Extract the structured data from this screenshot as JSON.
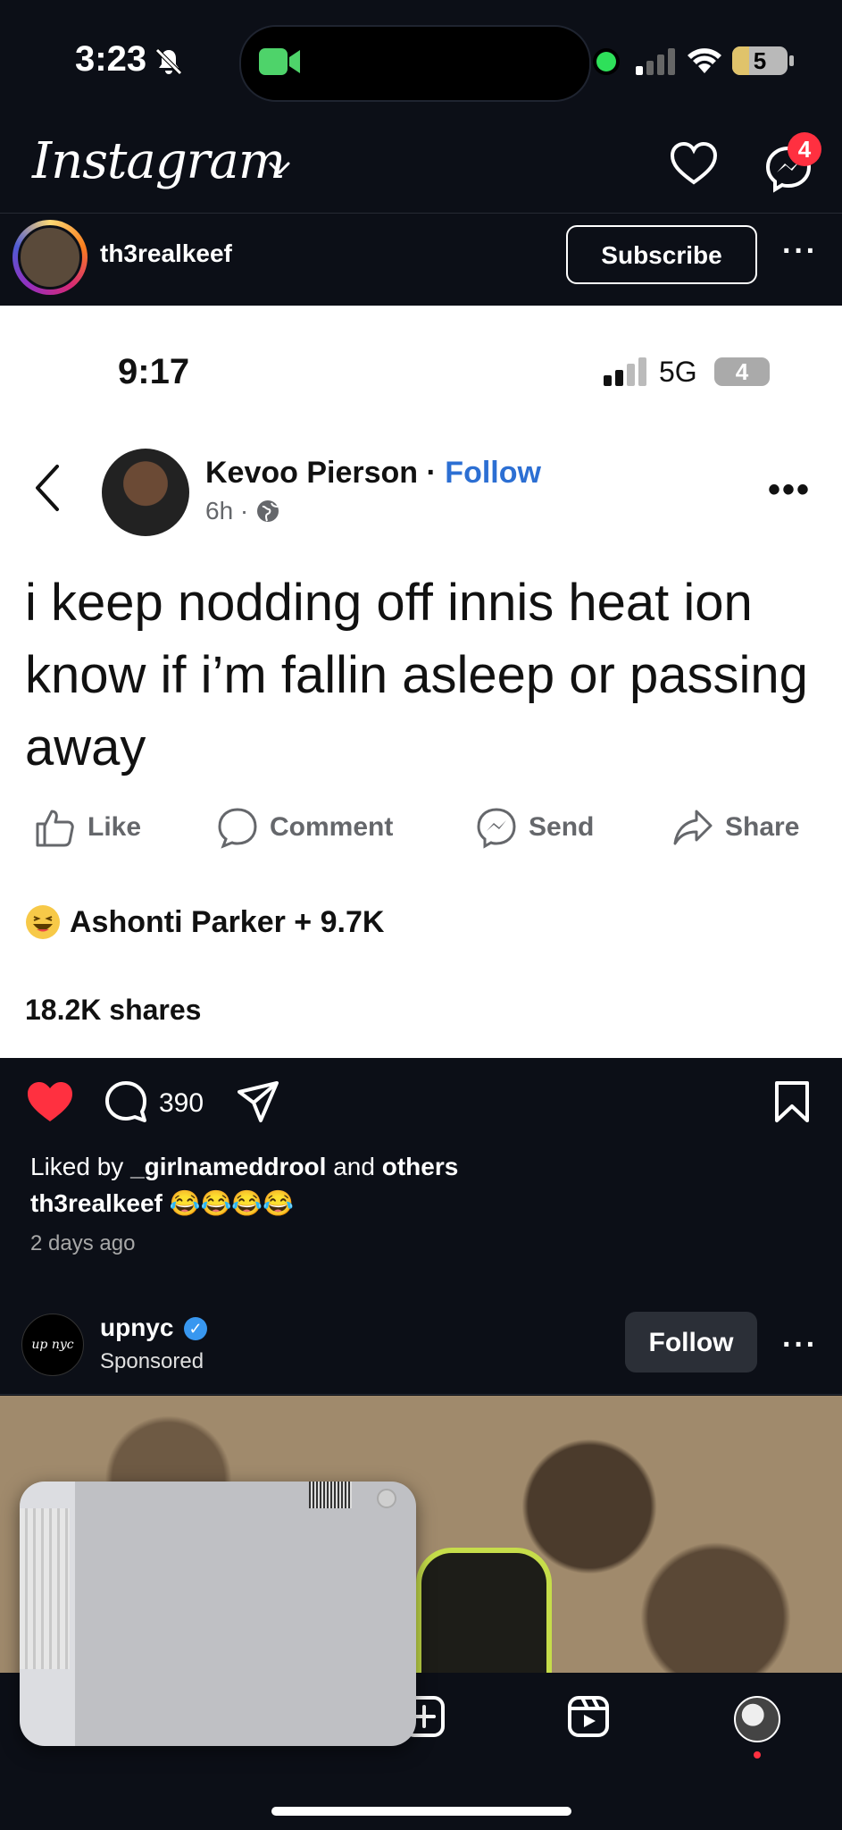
{
  "status_bar": {
    "time": "3:23",
    "battery": "5"
  },
  "header": {
    "logo": "Instagram",
    "messenger_badge": "4"
  },
  "story": {
    "username": "th3realkeef",
    "subscribe_label": "Subscribe",
    "more": "···"
  },
  "screenshot_post": {
    "status_time": "9:17",
    "network": "5G",
    "battery": "4",
    "author": "Kevoo Pierson",
    "separator": " · ",
    "follow_label": "Follow",
    "meta": "6h ·",
    "text": "i keep nodding off innis heat ion know if i’m fallin asleep or passing away",
    "actions": {
      "like": "Like",
      "comment": "Comment",
      "send": "Send",
      "share": "Share"
    },
    "reactions_text": "Ashonti Parker + 9.7K",
    "shares": "18.2K shares"
  },
  "ig_post": {
    "comment_count": "390",
    "liked_prefix": "Liked by ",
    "liked_user": "_girlnameddrool",
    "liked_middle": " and ",
    "liked_others": "others",
    "caption_user": "th3realkeef",
    "caption_text": " 😂😂😂😂",
    "time_ago": "2 days ago"
  },
  "sponsored": {
    "username": "upnyc",
    "label": "Sponsored",
    "follow_label": "Follow",
    "avatar_text": "up nyc"
  },
  "colors": {
    "accent_blue": "#2c6fd3",
    "like_red": "#ff3040",
    "bg_dark": "#0c0f17"
  }
}
